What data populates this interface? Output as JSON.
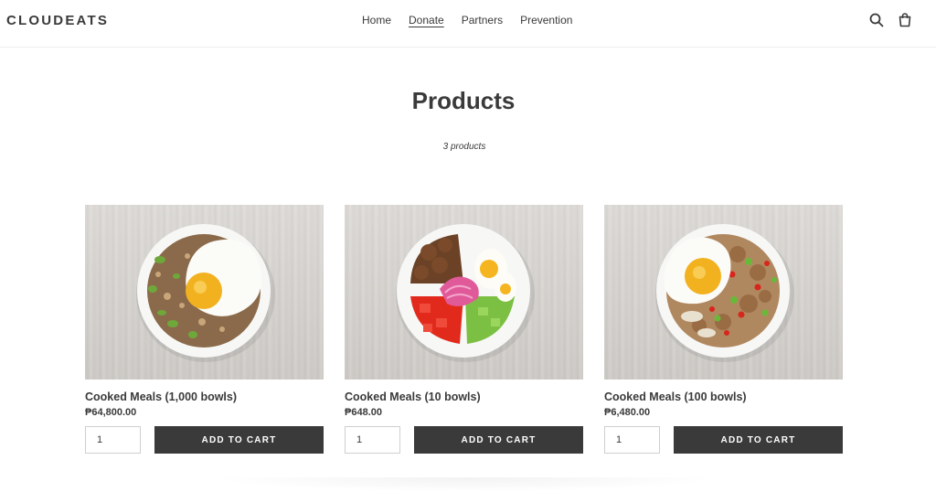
{
  "header": {
    "logo": "CLOUDEATS",
    "nav": [
      "Home",
      "Donate",
      "Partners",
      "Prevention"
    ],
    "active_nav": "Donate",
    "icons": [
      "search-icon",
      "cart-icon"
    ]
  },
  "collection": {
    "title": "Products",
    "count_label": "3 products"
  },
  "products": [
    {
      "name": "Cooked Meals (1,000 bowls)",
      "price": "₱64,800.00",
      "quantity": "1",
      "button": "ADD TO CART"
    },
    {
      "name": "Cooked Meals (10 bowls)",
      "price": "₱648.00",
      "quantity": "1",
      "button": "ADD TO CART"
    },
    {
      "name": "Cooked Meals (100 bowls)",
      "price": "₱6,480.00",
      "quantity": "1",
      "button": "ADD TO CART"
    }
  ],
  "colors": {
    "text": "#3a3a3a",
    "button_bg": "#3a3a3a",
    "button_text": "#ffffff"
  }
}
